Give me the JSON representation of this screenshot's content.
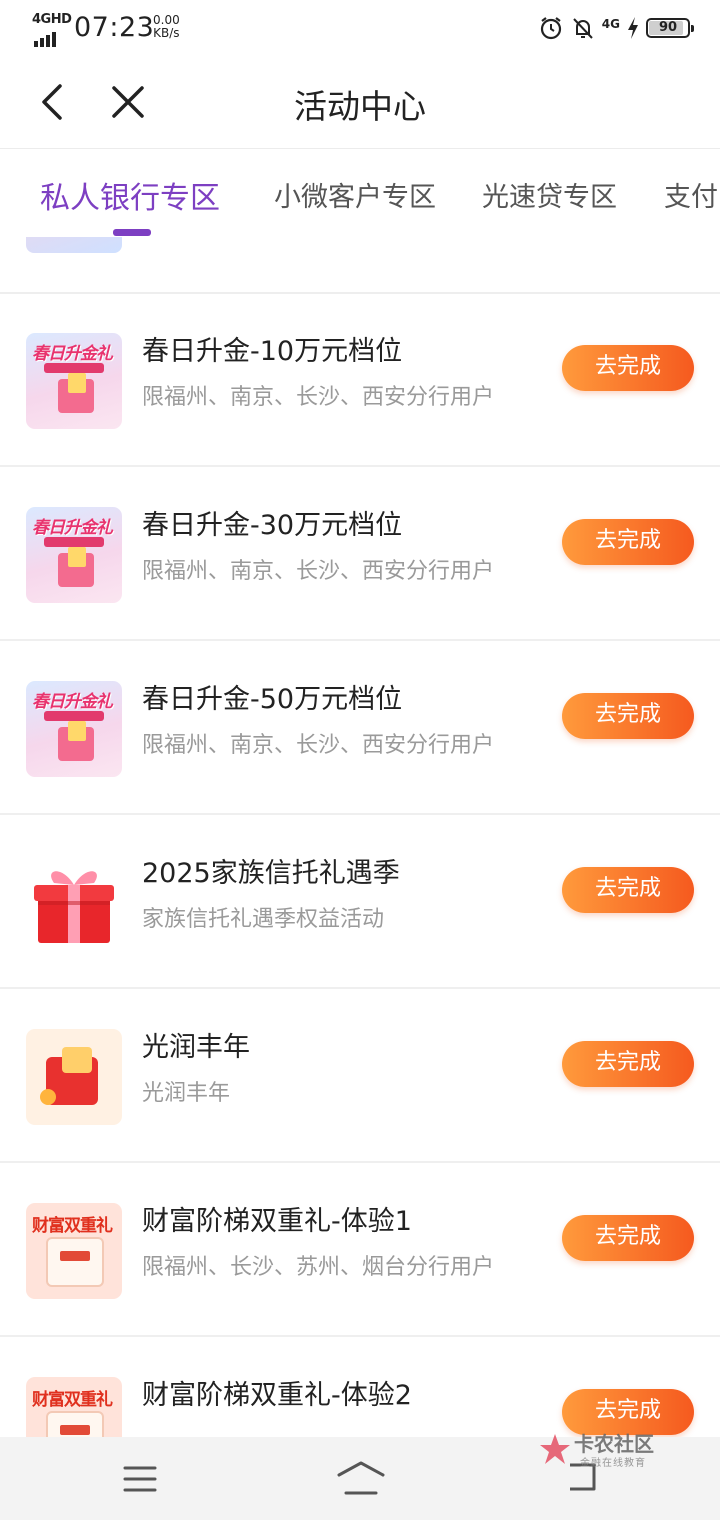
{
  "status_bar": {
    "network": "4GHD",
    "time": "07:23",
    "speed_value": "0.00",
    "speed_unit": "KB/s",
    "signal_4g": "4G",
    "battery": "90"
  },
  "header": {
    "title": "活动中心",
    "back_icon": "chevron-left-icon",
    "close_icon": "close-icon"
  },
  "tabs": [
    {
      "label": "私人银行专区",
      "active": true
    },
    {
      "label": "小微客户专区"
    },
    {
      "label": "光速贷专区"
    },
    {
      "label": "支付"
    }
  ],
  "activities": [
    {
      "thumb_text": "春日升金礼",
      "title": "春日升金-10万元档位",
      "subtitle": "限福州、南京、长沙、西安分行用户",
      "button": "去完成"
    },
    {
      "thumb_text": "春日升金礼",
      "title": "春日升金-30万元档位",
      "subtitle": "限福州、南京、长沙、西安分行用户",
      "button": "去完成"
    },
    {
      "thumb_text": "春日升金礼",
      "title": "春日升金-50万元档位",
      "subtitle": "限福州、南京、长沙、西安分行用户",
      "button": "去完成"
    },
    {
      "thumb_text": "",
      "title": "2025家族信托礼遇季",
      "subtitle": "家族信托礼遇季权益活动",
      "button": "去完成"
    },
    {
      "thumb_text": "",
      "title": "光润丰年",
      "subtitle": "光润丰年",
      "button": "去完成"
    },
    {
      "thumb_text": "财富双重礼",
      "title": "财富阶梯双重礼-体验1",
      "subtitle": "限福州、长沙、苏州、烟台分行用户",
      "button": "去完成"
    },
    {
      "thumb_text": "财富双重礼",
      "title": "财富阶梯双重礼-体验2",
      "subtitle": "",
      "button": "去完成"
    }
  ],
  "watermark": {
    "text": "卡农社区",
    "sub": "金融在线教育"
  },
  "colors": {
    "accent": "#7d3fc2",
    "button_start": "#ff9a3c",
    "button_end": "#f55a1f"
  }
}
